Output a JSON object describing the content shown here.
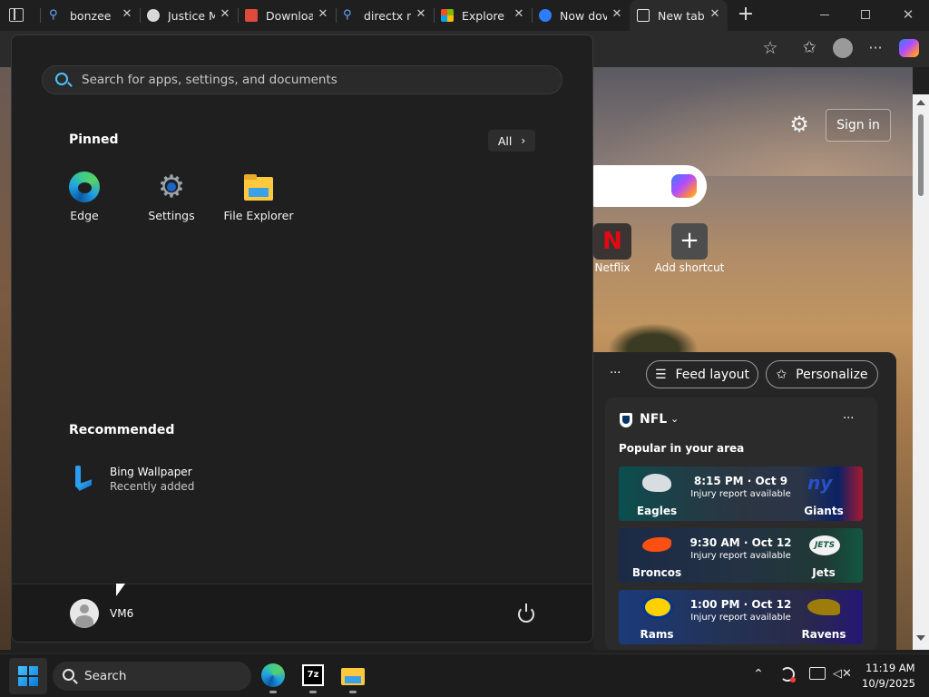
{
  "browser": {
    "tabs": [
      {
        "title": "bonzee r",
        "fav_color": "#3a7bd5"
      },
      {
        "title": "Justice M",
        "fav_color": "#d0d0d0"
      },
      {
        "title": "Downloa",
        "fav_color": "#e04a3a"
      },
      {
        "title": "directx n",
        "fav_color": "#3a7bd5"
      },
      {
        "title": "Explore I",
        "fav_color": "#f25022"
      },
      {
        "title": "Now dov",
        "fav_color": "#2e7dff"
      },
      {
        "title": "New tab",
        "fav_color": "#ffffff"
      }
    ],
    "new_tab_plus": "+"
  },
  "start_menu": {
    "search_placeholder": "Search for apps, settings, and documents",
    "pinned_title": "Pinned",
    "all_button": "All",
    "pinned_apps": [
      {
        "name": "Edge"
      },
      {
        "name": "Settings"
      },
      {
        "name": "File Explorer"
      }
    ],
    "recommended_title": "Recommended",
    "recommended": [
      {
        "name": "Bing Wallpaper",
        "subtitle": "Recently added"
      }
    ],
    "user_name": "VM6"
  },
  "new_tab_page": {
    "sign_in": "Sign in",
    "shortcuts": [
      {
        "name": "Netflix",
        "letter": "N"
      },
      {
        "name": "Add shortcut"
      }
    ],
    "feed_more": "···",
    "feed_layout": "Feed layout",
    "personalize": "Personalize",
    "nfl": {
      "title": "NFL",
      "subtitle": "Popular in your area",
      "more": "···",
      "games": [
        {
          "home": "Eagles",
          "away": "Giants",
          "time": "8:15 PM · Oct 9",
          "note": "Injury report available"
        },
        {
          "home": "Broncos",
          "away": "Jets",
          "time": "9:30 AM · Oct 12",
          "note": "Injury report available"
        },
        {
          "home": "Rams",
          "away": "Ravens",
          "time": "1:00 PM · Oct 12",
          "note": "Injury report available"
        }
      ]
    }
  },
  "taskbar": {
    "search_label": "Search",
    "time": "11:19 AM",
    "date": "10/9/2025"
  }
}
